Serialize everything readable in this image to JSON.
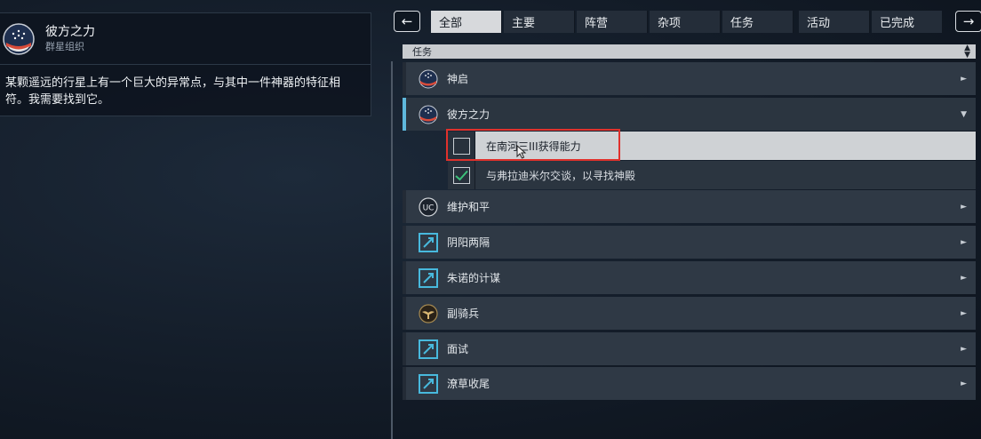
{
  "info": {
    "title": "彼方之力",
    "faction": "群星组织",
    "description": "某颗遥远的行星上有一个巨大的异常点，与其中一件神器的特征相符。我需要找到它。"
  },
  "tabs": {
    "prev_icon": "←",
    "next_icon": "→",
    "items": [
      {
        "label": "全部",
        "active": true
      },
      {
        "label": "主要"
      },
      {
        "label": "阵营"
      },
      {
        "label": "杂项"
      },
      {
        "label": "任务"
      },
      {
        "label": "活动"
      },
      {
        "label": "已完成"
      }
    ]
  },
  "list": {
    "category": "任务",
    "quests": [
      {
        "label": "神启",
        "icon": "constellation-logo-icon"
      },
      {
        "label": "彼方之力",
        "icon": "constellation-logo-icon",
        "expanded": true
      },
      {
        "label": "维护和平",
        "icon": "uc-emblem-icon"
      },
      {
        "label": "阴阳两隔",
        "icon": "mission-square-icon"
      },
      {
        "label": "朱诺的计谋",
        "icon": "mission-square-icon"
      },
      {
        "label": "副骑兵",
        "icon": "eagle-emblem-icon"
      },
      {
        "label": "面试",
        "icon": "mission-square-icon"
      },
      {
        "label": "潦草收尾",
        "icon": "mission-square-icon"
      }
    ],
    "objectives": [
      {
        "label": "在南河三III获得能力",
        "completed": false
      },
      {
        "label": "与弗拉迪米尔交谈，以寻找神殿",
        "completed": true
      }
    ]
  },
  "colors": {
    "accent": "#5fb8dc",
    "check": "#3cc27a",
    "highlight_frame": "#e0312c"
  }
}
